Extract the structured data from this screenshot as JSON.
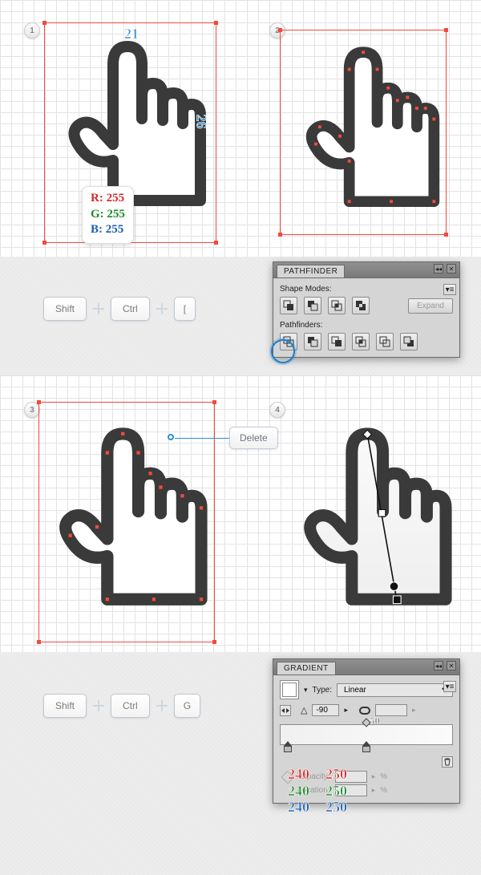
{
  "steps": {
    "s1": "1",
    "s2": "2",
    "s3": "3",
    "s4": "4"
  },
  "dims": {
    "top": "21",
    "side": "26"
  },
  "rgb": {
    "r_label": "R:",
    "r_val": "255",
    "g_label": "G:",
    "g_val": "255",
    "b_label": "B:",
    "b_val": "255"
  },
  "row1": {
    "k1": "Shift",
    "k2": "Ctrl",
    "k3": "["
  },
  "row2": {
    "k1": "Shift",
    "k2": "Ctrl",
    "k3": "G"
  },
  "pathfinder": {
    "title": "PATHFINDER",
    "shape_modes": "Shape Modes:",
    "pathfinders": "Pathfinders:",
    "expand": "Expand"
  },
  "delete_label": "Delete",
  "gradient": {
    "title": "GRADIENT",
    "type_label": "Type:",
    "type_value": "Linear",
    "opacity_label": "Opacity:",
    "location_label": "Location:",
    "pct": "%",
    "angle": "-90",
    "midpoint": "50"
  },
  "stops": {
    "left": {
      "r": "240",
      "g": "240",
      "b": "240"
    },
    "right": {
      "r": "250",
      "g": "250",
      "b": "250"
    }
  }
}
